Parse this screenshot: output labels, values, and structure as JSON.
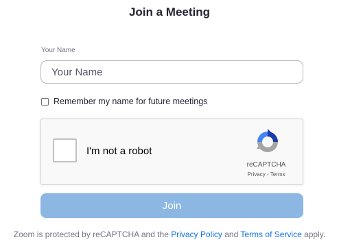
{
  "title": "Join a Meeting",
  "name_field": {
    "label": "Your Name",
    "placeholder": "Your Name",
    "value": ""
  },
  "remember": {
    "label": "Remember my name for future meetings",
    "checked": false
  },
  "recaptcha": {
    "checkbox_label": "I'm not a robot",
    "brand": "reCAPTCHA",
    "privacy_link": "Privacy",
    "separator": " - ",
    "terms_link": "Terms",
    "checked": false
  },
  "join_button": {
    "label": "Join",
    "enabled": false,
    "color": "#8db7e3"
  },
  "footer": {
    "text_1": "Zoom is protected by reCAPTCHA and the ",
    "privacy_link": "Privacy Policy",
    "text_2": " and ",
    "terms_link": "Terms of Service",
    "text_3": " apply."
  },
  "colors": {
    "link": "#0e72ed",
    "title_text": "#232333"
  }
}
